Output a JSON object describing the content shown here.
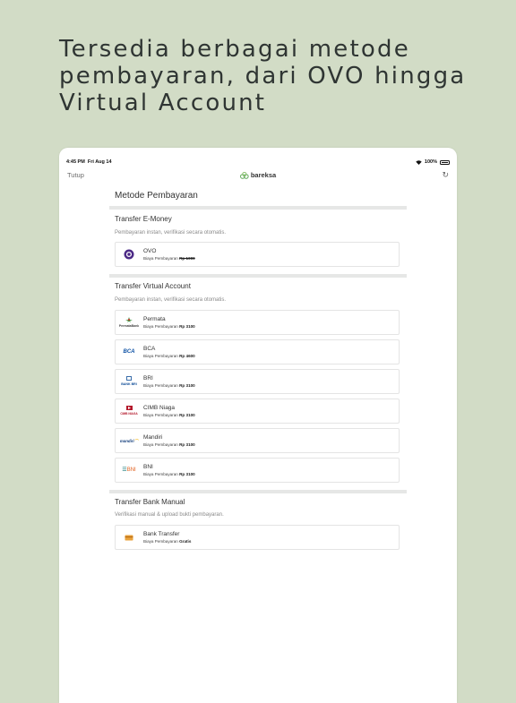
{
  "headline": {
    "line1": "Tersedia berbagai metode",
    "line2": "pembayaran, dari OVO hingga",
    "line3": "Virtual Account"
  },
  "status": {
    "time": "4:45 PM",
    "date": "Fri Aug 14",
    "battery": "100%"
  },
  "nav": {
    "close_label": "Tutup",
    "logo_text": "bareksa",
    "refresh_icon": "refresh-icon"
  },
  "page": {
    "title": "Metode Pembayaran"
  },
  "sections": {
    "emoney": {
      "title": "Transfer E-Money",
      "desc": "Pembayaran instan, verifikasi secara otomatis.",
      "items": [
        {
          "name": "OVO",
          "fee_label": "Biaya Pembayaran",
          "fee_value": "Rp 1000",
          "strikethrough": true,
          "icon": "ovo-logo"
        }
      ]
    },
    "va": {
      "title": "Transfer Virtual Account",
      "desc": "Pembayaran instan, verifikasi secara otomatis.",
      "items": [
        {
          "name": "Permata",
          "fee_label": "Biaya Pembayaran",
          "fee_value": "Rp 3100",
          "icon": "permata-logo",
          "logo_text": "PermataBank"
        },
        {
          "name": "BCA",
          "fee_label": "Biaya Pembayaran",
          "fee_value": "Rp 4600",
          "icon": "bca-logo",
          "logo_text": "BCA"
        },
        {
          "name": "BRI",
          "fee_label": "Biaya Pembayaran",
          "fee_value": "Rp 3100",
          "icon": "bri-logo",
          "logo_text": "BANK BRI"
        },
        {
          "name": "CIMB Niaga",
          "fee_label": "Biaya Pembayaran",
          "fee_value": "Rp 3100",
          "icon": "cimb-logo",
          "logo_text": "CIMB NIAGA"
        },
        {
          "name": "Mandiri",
          "fee_label": "Biaya Pembayaran",
          "fee_value": "Rp 3100",
          "icon": "mandiri-logo",
          "logo_text": "mandiri"
        },
        {
          "name": "BNI",
          "fee_label": "Biaya Pembayaran",
          "fee_value": "Rp 3100",
          "icon": "bni-logo",
          "logo_text": "BNI"
        }
      ]
    },
    "manual": {
      "title": "Transfer Bank Manual",
      "desc": "Verifikasi manual & upload bukti pembayaran.",
      "items": [
        {
          "name": "Bank Transfer",
          "fee_label": "Biaya Pembayaran",
          "fee_value": "Gratis",
          "icon": "bank-transfer-icon"
        }
      ]
    }
  },
  "colors": {
    "background": "#d2dcc6",
    "brand_green": "#5fa85a",
    "ovo_purple": "#4c2a86",
    "bca_blue": "#0a4fa3",
    "cimb_red": "#b3172a",
    "bni_orange": "#e2601f"
  }
}
